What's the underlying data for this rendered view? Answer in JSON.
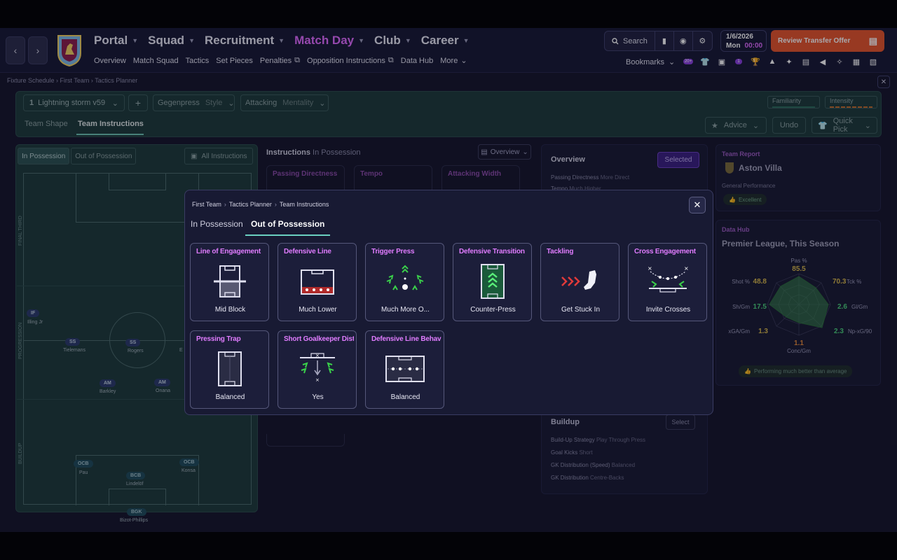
{
  "nav": {
    "items": [
      "Portal",
      "Squad",
      "Recruitment",
      "Match Day",
      "Club",
      "Career"
    ],
    "active": "Match Day",
    "sub": [
      "Overview",
      "Match Squad",
      "Tactics",
      "Set Pieces",
      "Penalties",
      "Opposition Instructions",
      "Data Hub",
      "More"
    ]
  },
  "toolbar": {
    "search_label": "Search"
  },
  "date": {
    "date": "1/6/2026",
    "day": "Mon",
    "time": "00:00"
  },
  "review_button": "Review Transfer Offer",
  "bookmarks_label": "Bookmarks",
  "badges": {
    "b1": "20+",
    "b2": "1"
  },
  "breadcrumb_top": [
    "Fixture Schedule",
    "First Team",
    "Tactics Planner"
  ],
  "tactics": {
    "number": "1",
    "name": "Lightning storm v59",
    "style_value": "Gegenpress",
    "style_label": "Style",
    "mentality_value": "Attacking",
    "mentality_label": "Mentality",
    "familiarity": "Familiarity",
    "intensity": "Intensity",
    "tabs": [
      "Team Shape",
      "Team Instructions"
    ],
    "advice": "Advice",
    "undo": "Undo",
    "quick_pick": "Quick Pick"
  },
  "pitch_panel": {
    "in_possession": "In Possession",
    "out_possession": "Out of Possession",
    "all_instructions": "All Instructions",
    "zones": [
      "FINAL THIRD",
      "PROGRESSION",
      "BUILDUP"
    ],
    "players": [
      {
        "role": "IF",
        "name": "Illing Jr"
      },
      {
        "role": "SS",
        "name": "Tielemans"
      },
      {
        "role": "SS",
        "name": "Rogers"
      },
      {
        "role": "AM",
        "name": "Barkley"
      },
      {
        "role": "AM",
        "name": "Onana"
      },
      {
        "role": "OCB",
        "name": "Pau"
      },
      {
        "role": "BCB",
        "name": "Lindelöf"
      },
      {
        "role": "OCB",
        "name": "Konsa"
      },
      {
        "role": "BGK",
        "name": "Bizot-Phillips"
      }
    ],
    "partial_name": "E"
  },
  "instructions_bg": {
    "title": "Instructions",
    "subtitle": "In Possession",
    "overview": "Overview",
    "cards": [
      "Passing Directness",
      "Tempo",
      "Attacking Width"
    ]
  },
  "overview_panel": {
    "title": "Overview",
    "selected": "Selected",
    "lines": [
      {
        "label": "Passing Directness",
        "value": "More Direct"
      },
      {
        "label": "Tempo",
        "value": "Much Higher"
      }
    ],
    "buildup_title": "Buildup",
    "select": "Select",
    "buildup_lines": [
      {
        "label": "Build-Up Strategy",
        "value": "Play Through Press"
      },
      {
        "label": "Goal Kicks",
        "value": "Short"
      },
      {
        "label": "GK Distribution (Speed)",
        "value": "Balanced"
      },
      {
        "label": "GK Distribution",
        "value": "Centre-Backs"
      }
    ]
  },
  "team_report": {
    "label": "Team Report",
    "team": "Aston Villa",
    "general": "General Performance",
    "rating": "Excellent"
  },
  "data_hub": {
    "label": "Data Hub",
    "subtitle": "Premier League, This Season",
    "footer": "Performing much better than average"
  },
  "radar": {
    "axes": [
      {
        "name": "Pas %",
        "value": "85.5",
        "color": "#d8b84a"
      },
      {
        "name": "Tck %",
        "value": "70.3",
        "color": "#d8b84a"
      },
      {
        "name": "Gl/Gm",
        "value": "2.6",
        "color": "#4ad07a"
      },
      {
        "name": "Np-xG/90",
        "value": "2.3",
        "color": "#4ad07a"
      },
      {
        "name": "Conc/Gm",
        "value": "1.1",
        "color": "#e0883a"
      },
      {
        "name": "xGA/Gm",
        "value": "1.3",
        "color": "#d8b84a"
      },
      {
        "name": "Sh/Gm",
        "value": "17.5",
        "color": "#4ad07a"
      },
      {
        "name": "Shot %",
        "value": "48.8",
        "color": "#d8b84a"
      }
    ]
  },
  "modal": {
    "crumbs": [
      "First Team",
      "Tactics Planner",
      "Team Instructions"
    ],
    "tabs": [
      "In Possession",
      "Out of Possession"
    ],
    "cards": [
      {
        "title": "Line of Engagement",
        "value": "Mid Block",
        "icon": "mid-block-pitch-icon"
      },
      {
        "title": "Defensive Line",
        "value": "Much Lower",
        "icon": "low-line-pitch-icon"
      },
      {
        "title": "Trigger Press",
        "value": "Much More O...",
        "icon": "trigger-press-arrows-icon"
      },
      {
        "title": "Defensive Transition",
        "value": "Counter-Press",
        "icon": "counter-press-pitch-icon"
      },
      {
        "title": "Tackling",
        "value": "Get Stuck In",
        "icon": "boot-tackle-icon"
      },
      {
        "title": "Cross Engagement",
        "value": "Invite Crosses",
        "icon": "invite-crosses-icon"
      },
      {
        "title": "Pressing Trap",
        "value": "Balanced",
        "icon": "pressing-trap-pitch-icon"
      },
      {
        "title": "Short Goalkeeper Distr",
        "value": "Yes",
        "icon": "goalkeeper-distribution-icon"
      },
      {
        "title": "Defensive Line Behavio",
        "value": "Balanced",
        "icon": "line-behaviour-pitch-icon"
      }
    ],
    "accent": "#e07cff"
  }
}
